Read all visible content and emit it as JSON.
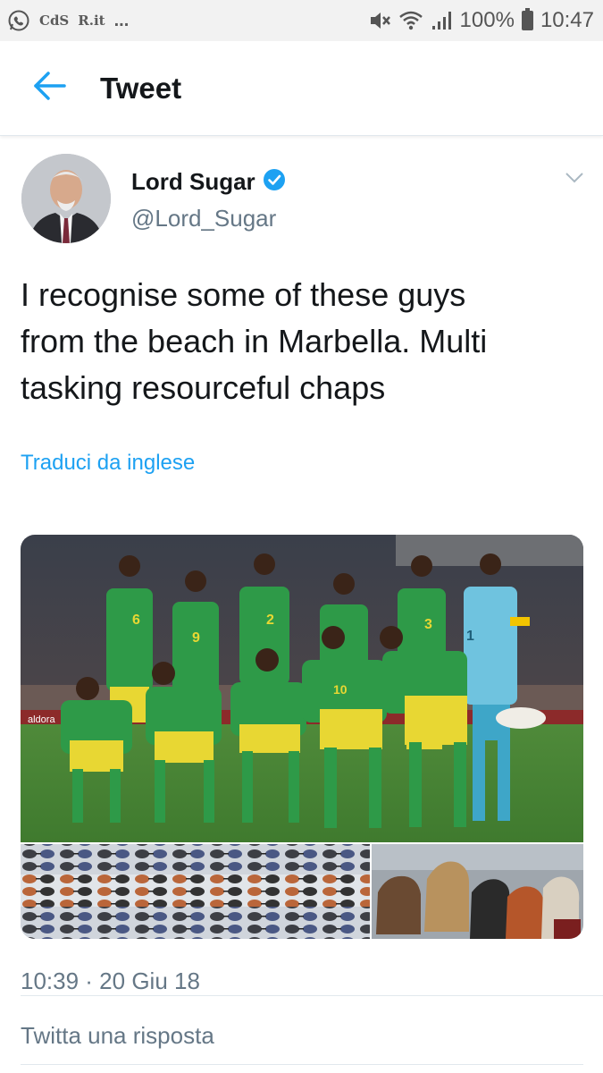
{
  "status_bar": {
    "left_labels": [
      "CdS",
      "R.it",
      "..."
    ],
    "battery_text": "100%",
    "time": "10:47",
    "icons": [
      "whatsapp-icon",
      "mute-icon",
      "wifi-icon",
      "signal-icon",
      "battery-icon"
    ]
  },
  "header": {
    "title": "Tweet",
    "back_icon": "arrow-left-icon"
  },
  "tweet": {
    "author_name": "Lord Sugar",
    "author_handle": "@Lord_Sugar",
    "verified": true,
    "text_lines": [
      "I recognise some of these guys",
      "from the beach in Marbella. Multi",
      "tasking resourceful chaps"
    ],
    "translate_label": "Traduci da inglese",
    "media": {
      "jersey_numbers": [
        "6",
        "9",
        "2",
        "3",
        "1",
        "10"
      ],
      "ad_text": "aldora"
    },
    "timestamp": "10:39 · 20 Giu 18",
    "reply_placeholder": "Twitta una risposta"
  },
  "colors": {
    "accent": "#1da1f2",
    "muted": "#657786",
    "text": "#14171a",
    "kit_green": "#2e9a48",
    "kit_yellow": "#e8d733"
  }
}
